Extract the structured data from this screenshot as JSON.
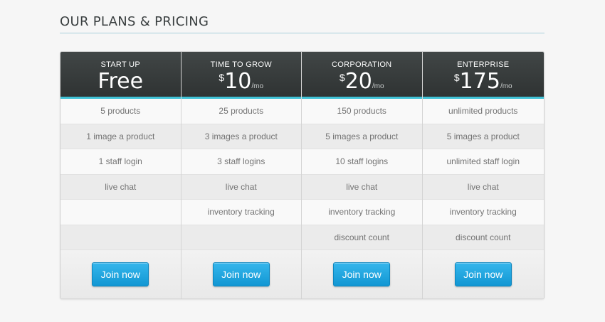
{
  "page": {
    "title": "OUR PLANS & PRICING"
  },
  "colors": {
    "header_bg": "#353a3a",
    "accent_line": "#3fc2d6",
    "button": "#1fa6e0",
    "rule": "#a9cfdc"
  },
  "plans": [
    {
      "name": "START UP",
      "price_text": "Free",
      "currency": "",
      "amount": "",
      "period": "",
      "features": [
        "5 products",
        "1 image a product",
        "1 staff login",
        "live chat",
        "",
        ""
      ],
      "button_label": "Join now"
    },
    {
      "name": "TIME TO GROW",
      "price_text": "",
      "currency": "$",
      "amount": "10",
      "period": "/mo",
      "features": [
        "25 products",
        "3 images a product",
        "3 staff logins",
        "live chat",
        "inventory tracking",
        ""
      ],
      "button_label": "Join now"
    },
    {
      "name": "CORPORATION",
      "price_text": "",
      "currency": "$",
      "amount": "20",
      "period": "/mo",
      "features": [
        "150 products",
        "5 images a product",
        "10 staff logins",
        "live chat",
        "inventory tracking",
        "discount count"
      ],
      "button_label": "Join now"
    },
    {
      "name": "ENTERPRISE",
      "price_text": "",
      "currency": "$",
      "amount": "175",
      "period": "/mo",
      "features": [
        "unlimited products",
        "5 images a product",
        "unlimited staff login",
        "live chat",
        "inventory tracking",
        "discount count"
      ],
      "button_label": "Join now"
    }
  ]
}
